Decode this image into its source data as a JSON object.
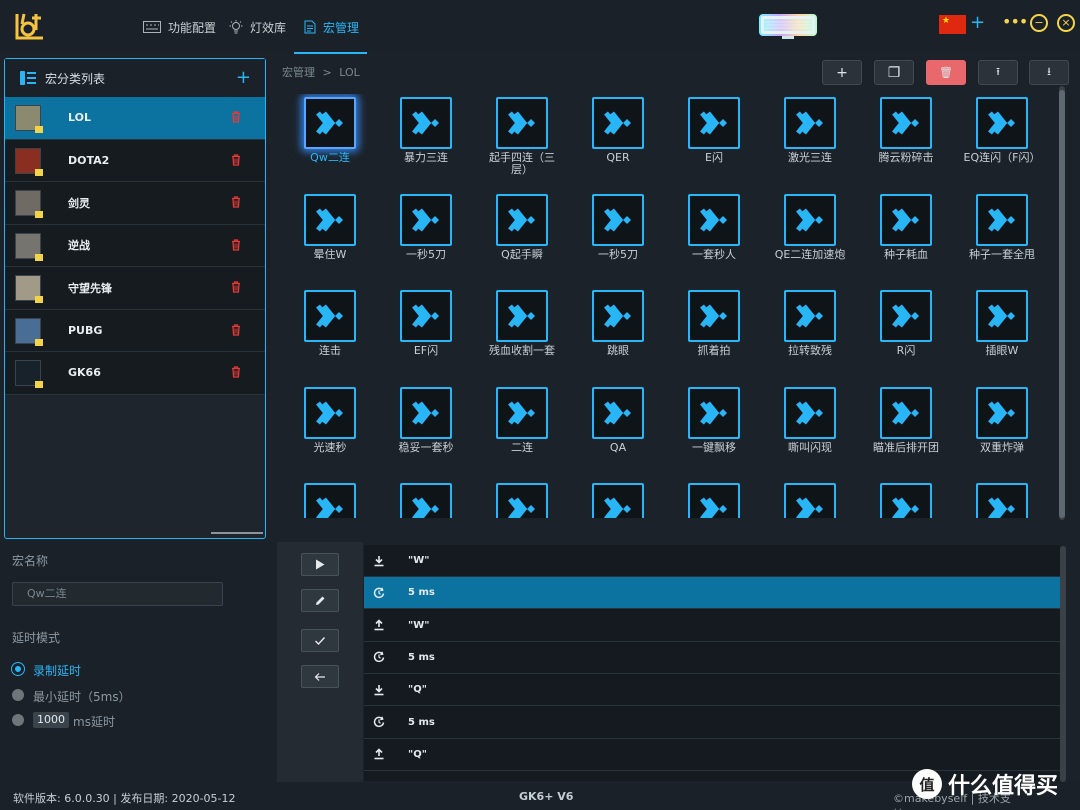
{
  "nav": {
    "items": [
      {
        "label": "功能配置",
        "icon": "keyboard-icon"
      },
      {
        "label": "灯效库",
        "icon": "light-bulb-icon"
      },
      {
        "label": "宏管理",
        "icon": "document-icon"
      }
    ],
    "active": "宏管理"
  },
  "colors": {
    "accent": "#29b6f6",
    "selected_row": "#0c73a1",
    "delete_button": "#e9686b",
    "header_icons": "#f5d547"
  },
  "sidebar": {
    "title": "宏分类列表",
    "items": [
      {
        "label": "LOL"
      },
      {
        "label": "DOTA2"
      },
      {
        "label": "剑灵"
      },
      {
        "label": "逆战"
      },
      {
        "label": "守望先锋"
      },
      {
        "label": "PUBG"
      },
      {
        "label": "GK66"
      }
    ]
  },
  "breadcrumb": {
    "root": "宏管理",
    "sep": ">",
    "current": "LOL"
  },
  "toolbar": {
    "add": "+",
    "copy": "❐",
    "delete": "🗑",
    "upload": "⭱",
    "download": "⭳"
  },
  "macros": [
    "Qw二连",
    "暴力三连",
    "起手四连（三层）",
    "QER",
    "E闪",
    "激光三连",
    "腾云粉碎击",
    "EQ连闪（F闪）",
    "晕住W",
    "一秒5刀",
    "Q起手瞬",
    "一秒5刀",
    "一套秒人",
    "QE二连加速炮",
    "种子耗血",
    "种子一套全甩",
    "连击",
    "EF闪",
    "残血收割一套",
    "跳眼",
    "抓着拍",
    "拉转致残",
    "R闪",
    "插眼W",
    "光速秒",
    "稳妥一套秒",
    "二连",
    "QA",
    "一键飘移",
    "嘶叫闪现",
    "瞄准后排开团",
    "双重炸弹",
    "",
    "",
    "",
    "",
    "",
    "",
    "",
    ""
  ],
  "form": {
    "name_label": "宏名称",
    "name_placeholder": "Qw二连",
    "delay_label": "延时模式",
    "opt_record": "录制延时",
    "opt_min": "最小延时（5ms）",
    "opt_custom_value": "1000",
    "opt_custom_unit": "ms延时"
  },
  "steps": [
    {
      "icon": "key-down-icon",
      "text": "\"W\""
    },
    {
      "icon": "delay-icon",
      "text": "5 ms"
    },
    {
      "icon": "key-up-icon",
      "text": "\"W\""
    },
    {
      "icon": "delay-icon",
      "text": "5 ms"
    },
    {
      "icon": "key-down-icon",
      "text": "\"Q\""
    },
    {
      "icon": "delay-icon",
      "text": "5 ms"
    },
    {
      "icon": "key-up-icon",
      "text": "\"Q\""
    }
  ],
  "status": {
    "version": "软件版本: 6.0.0.30 | 发布日期: 2020-05-12",
    "model": "GK6+ V6",
    "support": "©makebyself | 技术支持:makebyself"
  },
  "watermark": {
    "badge": "值",
    "text": "什么值得买"
  }
}
